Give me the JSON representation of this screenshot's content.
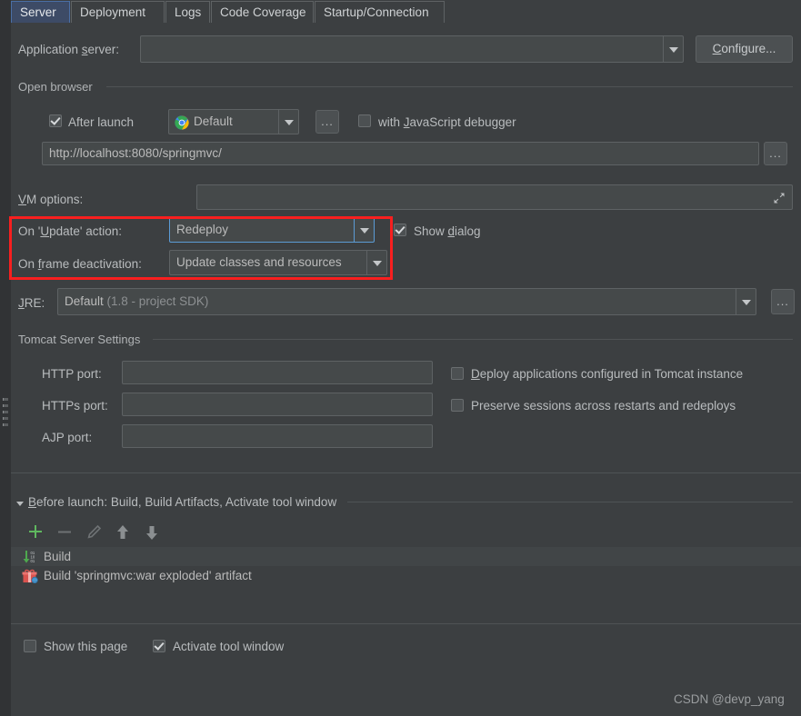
{
  "tabs": [
    {
      "label": "Server",
      "selected": true
    },
    {
      "label": "Deployment",
      "selected": false
    },
    {
      "label": "Logs",
      "selected": false
    },
    {
      "label": "Code Coverage",
      "selected": false
    },
    {
      "label": "Startup/Connection",
      "selected": false
    }
  ],
  "application_server": {
    "label_pre": "Application ",
    "label_mnemonic": "s",
    "label_post": "erver:",
    "value": "",
    "configure_button_pre": "",
    "configure_button_mnemonic": "C",
    "configure_button_post": "onfigure..."
  },
  "open_browser": {
    "group_title": "Open browser",
    "after_launch": {
      "label": "After launch",
      "checked": true
    },
    "browser": {
      "value": "Default",
      "icon": "chrome-icon"
    },
    "browse_button": "...",
    "js_debugger": {
      "label_pre": "with ",
      "label_mnemonic": "J",
      "label_post": "avaScript debugger",
      "checked": false
    },
    "url": {
      "value": "http://localhost:8080/springmvc/",
      "browse_button": "..."
    }
  },
  "vm_options": {
    "label_pre": "",
    "label_mnemonic": "V",
    "label_post": "M options:",
    "value": "",
    "expand_icon": "expand-icon"
  },
  "on_update_action": {
    "label_pre": "On '",
    "label_mnemonic": "U",
    "label_post": "pdate' action:",
    "value": "Redeploy",
    "focused": true
  },
  "show_dialog": {
    "label_pre": "Show ",
    "label_mnemonic": "d",
    "label_post": "ialog",
    "checked": true
  },
  "on_frame_deactivation": {
    "label_pre": "On ",
    "label_mnemonic": "f",
    "label_post": "rame deactivation:",
    "value": "Update classes and resources"
  },
  "jre": {
    "label_pre": "",
    "label_mnemonic": "J",
    "label_post": "RE:",
    "value_main": "Default",
    "value_dim": "(1.8 - project SDK)",
    "browse_button": "..."
  },
  "tomcat_settings": {
    "group_title": "Tomcat Server Settings",
    "http_port": {
      "label": "HTTP port:",
      "value": ""
    },
    "https_port": {
      "label": "HTTPs port:",
      "value": ""
    },
    "ajp_port": {
      "label": "AJP port:",
      "value": ""
    },
    "deploy_apps": {
      "label_pre": "",
      "label_mnemonic": "D",
      "label_post": "eploy applications configured in Tomcat instance",
      "checked": false
    },
    "preserve_sessions": {
      "label": "Preserve sessions across restarts and redeploys",
      "checked": false
    }
  },
  "before_launch": {
    "title_pre": "",
    "title_mnemonic": "B",
    "title_post": "efore launch: Build, Build Artifacts, Activate tool window",
    "collapse_icon": "triangle-down-icon",
    "toolbar": [
      {
        "name": "add-button",
        "icon": "plus-icon",
        "enabled": true
      },
      {
        "name": "remove-button",
        "icon": "minus-icon",
        "enabled": false
      },
      {
        "name": "edit-button",
        "icon": "pencil-icon",
        "enabled": false
      },
      {
        "name": "move-up-button",
        "icon": "arrow-up-icon",
        "enabled": false
      },
      {
        "name": "move-down-button",
        "icon": "arrow-down-icon",
        "enabled": false
      }
    ],
    "items": [
      {
        "label": "Build",
        "icon": "build-icon"
      },
      {
        "label": "Build 'springmvc:war exploded' artifact",
        "icon": "artifact-icon"
      }
    ]
  },
  "footer": {
    "show_this_page": {
      "label": "Show this page",
      "checked": false
    },
    "activate_tool_window": {
      "label": "Activate tool window",
      "checked": true
    }
  },
  "watermark": "CSDN @devp_yang",
  "colors": {
    "background": "#3c3f41",
    "field_background": "#45494a",
    "accent_blue": "#5b9bd5",
    "tab_selected": "#3d4b66",
    "annotation_red": "#f81f1f",
    "text": "#bbbbbb"
  }
}
